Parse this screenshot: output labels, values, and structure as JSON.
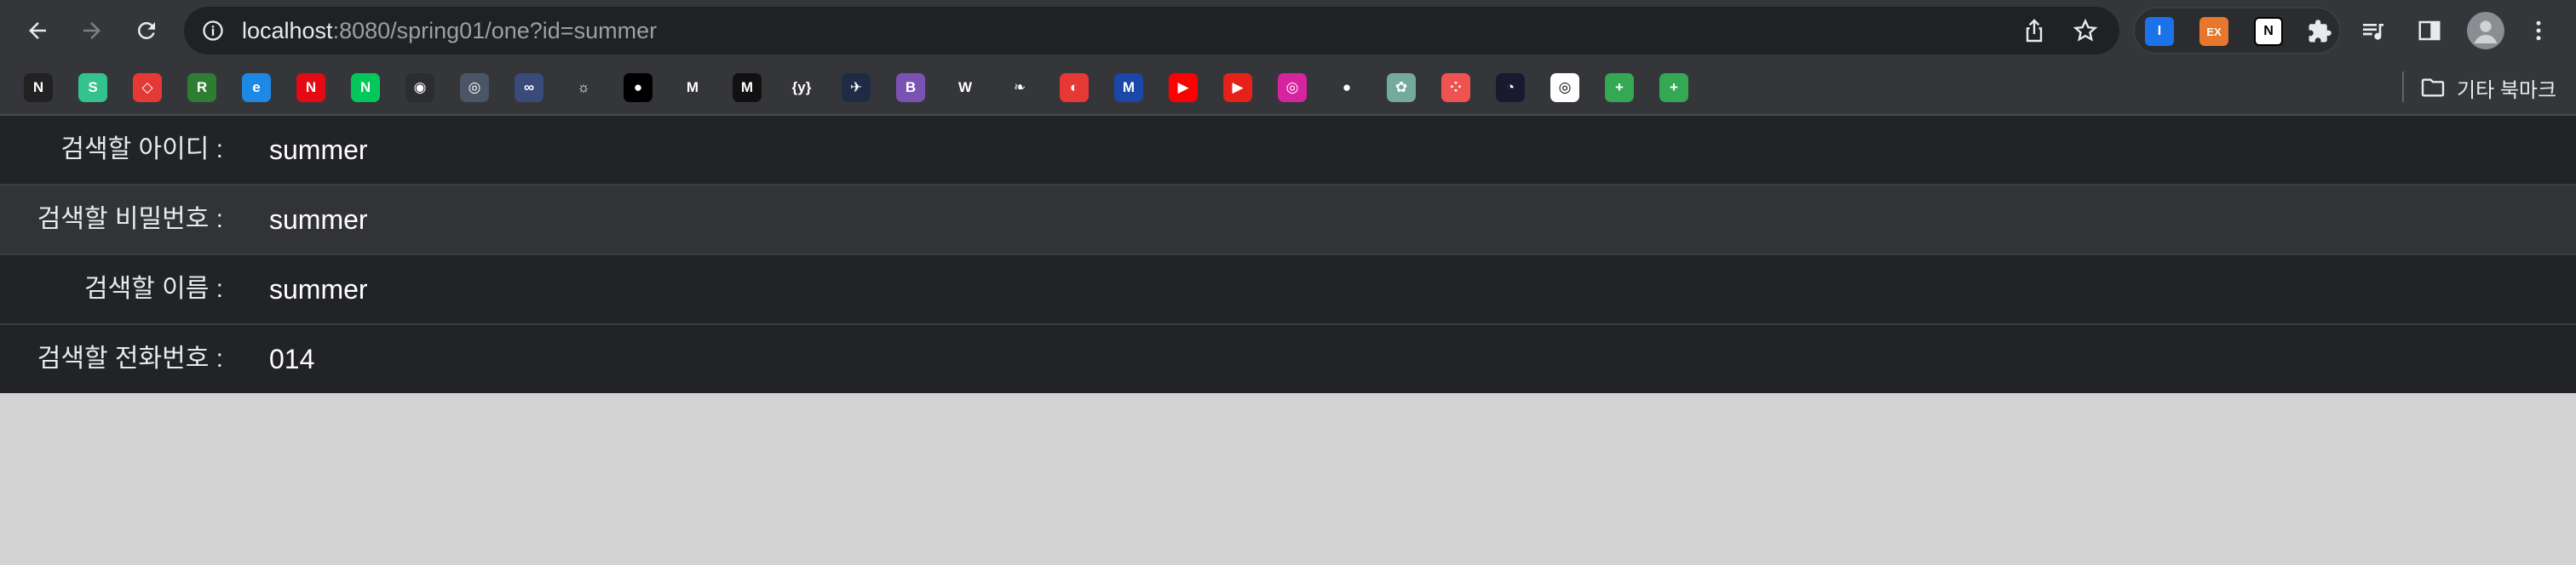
{
  "browser": {
    "url_host": "localhost",
    "url_rest": ":8080/spring01/one?id=summer",
    "icons": [
      "back-arrow-icon",
      "forward-arrow-icon",
      "reload-icon",
      "info-icon",
      "share-icon",
      "star-icon",
      "puzzle-icon",
      "media-control-icon",
      "side-panel-icon",
      "kebab-menu-icon"
    ],
    "extensions": [
      {
        "name": "1password-extension",
        "glyph": "I",
        "color": "#1a73e8"
      },
      {
        "name": "ex-extension",
        "glyph": "EX",
        "color": "#e8772e"
      },
      {
        "name": "notion-extension",
        "glyph": "N",
        "color": "#ffffff"
      }
    ]
  },
  "bookmarks": {
    "items": [
      {
        "name": "bookmark-notion-ai",
        "glyph": "N",
        "color": "#222222"
      },
      {
        "name": "bookmark-green-s",
        "glyph": "S",
        "color": "#34c38f"
      },
      {
        "name": "bookmark-red-square",
        "glyph": "◇",
        "color": "#e53935"
      },
      {
        "name": "bookmark-r",
        "glyph": "R",
        "color": "#2e7d32"
      },
      {
        "name": "bookmark-edge",
        "glyph": "e",
        "color": "#1e88e5"
      },
      {
        "name": "bookmark-netflix",
        "glyph": "N",
        "color": "#e50914"
      },
      {
        "name": "bookmark-naver",
        "glyph": "N",
        "color": "#03c75a"
      },
      {
        "name": "bookmark-discord",
        "glyph": "◉",
        "color": "#2b2d31"
      },
      {
        "name": "bookmark-app",
        "glyph": "◎",
        "color": "#4a5568"
      },
      {
        "name": "bookmark-cloud",
        "glyph": "∞",
        "color": "#3a4a7a"
      },
      {
        "name": "bookmark-sun",
        "glyph": "☼",
        "color": "#35363a"
      },
      {
        "name": "bookmark-black-circle",
        "glyph": "●",
        "color": "#000000"
      },
      {
        "name": "bookmark-m-yellow",
        "glyph": "M",
        "color": "#35363a"
      },
      {
        "name": "bookmark-m-italic",
        "glyph": "M",
        "color": "#111111"
      },
      {
        "name": "bookmark-braces",
        "glyph": "{y}",
        "color": "#35363a"
      },
      {
        "name": "bookmark-bird",
        "glyph": "✈",
        "color": "#1f2a44"
      },
      {
        "name": "bookmark-bootstrap",
        "glyph": "B",
        "color": "#7952b3"
      },
      {
        "name": "bookmark-w",
        "glyph": "W",
        "color": "#35363a"
      },
      {
        "name": "bookmark-leaf",
        "glyph": "❧",
        "color": "#35363a"
      },
      {
        "name": "bookmark-red-circle",
        "glyph": "◐",
        "color": "#e53935"
      },
      {
        "name": "bookmark-m-blue",
        "glyph": "M",
        "color": "#1a47a8"
      },
      {
        "name": "bookmark-youtube",
        "glyph": "▶",
        "color": "#ff0000"
      },
      {
        "name": "bookmark-youtube-music",
        "glyph": "▶",
        "color": "#e62117"
      },
      {
        "name": "bookmark-instagram",
        "glyph": "◎",
        "color": "#d6249f"
      },
      {
        "name": "bookmark-github",
        "glyph": "●",
        "color": "#35363a"
      },
      {
        "name": "bookmark-chatgpt",
        "glyph": "✿",
        "color": "#74aa9c"
      },
      {
        "name": "bookmark-dots",
        "glyph": "⁘",
        "color": "#ef5350"
      },
      {
        "name": "bookmark-search",
        "glyph": "◔",
        "color": "#1a1a2e"
      },
      {
        "name": "bookmark-target",
        "glyph": "◎",
        "color": "#ffffff"
      },
      {
        "name": "bookmark-sheets-1",
        "glyph": "+",
        "color": "#34a853"
      },
      {
        "name": "bookmark-sheets-2",
        "glyph": "+",
        "color": "#34a853"
      }
    ],
    "folder_label": "기타 북마크"
  },
  "page": {
    "rows": [
      {
        "label": "검색할 아이디 :",
        "value": "summer"
      },
      {
        "label": "검색할 비밀번호 :",
        "value": "summer"
      },
      {
        "label": "검색할 이름 :",
        "value": "summer"
      },
      {
        "label": "검색할 전화번호 :",
        "value": "014"
      }
    ]
  }
}
